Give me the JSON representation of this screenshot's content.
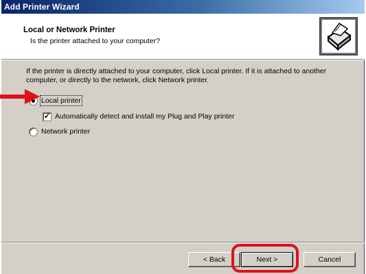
{
  "window": {
    "title": "Add Printer Wizard"
  },
  "header": {
    "title": "Local or Network Printer",
    "subtitle": "Is the printer attached to your computer?",
    "icon": "printer-icon"
  },
  "body": {
    "description": "If the printer is directly attached to your computer, click Local printer.  If it is attached to another computer, or directly to the network, click Network printer."
  },
  "options": {
    "local": {
      "label": "Local printer",
      "selected": true
    },
    "auto_detect": {
      "label": "Automatically detect and install my Plug and Play printer",
      "checked": true
    },
    "network": {
      "label": "Network printer",
      "selected": false
    }
  },
  "buttons": {
    "back": "< Back",
    "next": "Next >",
    "cancel": "Cancel"
  },
  "annotations": {
    "highlight_color": "#e0101c"
  }
}
